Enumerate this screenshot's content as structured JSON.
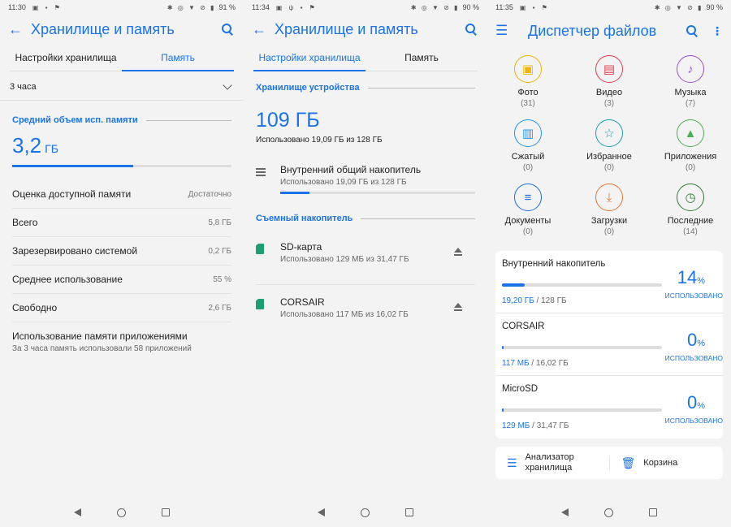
{
  "panels": [
    {
      "status": {
        "time": "11:30",
        "battery": "91 %"
      },
      "title": "Хранилище и память",
      "tabs": [
        "Настройки хранилища",
        "Память"
      ],
      "period": "3 часа",
      "section": "Средний объем исп. памяти",
      "big_value": "3,2",
      "big_unit": "ГБ",
      "bar_fraction": 0.55,
      "rows": [
        {
          "k": "Оценка доступной памяти",
          "v": "Достаточно"
        },
        {
          "k": "Всего",
          "v": "5,8 ГБ"
        },
        {
          "k": "Зарезервировано системой",
          "v": "0,2 ГБ"
        },
        {
          "k": "Среднее использование",
          "v": "55 %"
        },
        {
          "k": "Свободно",
          "v": "2,6 ГБ"
        }
      ],
      "apps_title": "Использование памяти приложениями",
      "apps_sub": "За 3 часа память использовали 58 приложений"
    },
    {
      "status": {
        "time": "11:34",
        "battery": "90 %"
      },
      "title": "Хранилище и память",
      "tabs": [
        "Настройки хранилища",
        "Память"
      ],
      "device_section": "Хранилище устройства",
      "device_total": "109 ГБ",
      "device_used": "Использовано 19,09 ГБ из 128 ГБ",
      "internal": {
        "title": "Внутренний общий накопитель",
        "sub": "Использовано 19,09 ГБ из 128 ГБ",
        "fraction": 0.15
      },
      "removable_section": "Съемный накопитель",
      "removable": [
        {
          "title": "SD-карта",
          "sub": "Использовано 129 МБ из 31,47 ГБ"
        },
        {
          "title": "CORSAIR",
          "sub": "Использовано 117 МБ из 16,02 ГБ"
        }
      ]
    },
    {
      "status": {
        "time": "11:35",
        "battery": "90 %"
      },
      "title": "Диспетчер файлов",
      "categories": [
        {
          "label": "Фото",
          "count": "(31)",
          "icon": "photo-icon",
          "glyph": "▣",
          "color": "#f0b400"
        },
        {
          "label": "Видео",
          "count": "(3)",
          "icon": "video-icon",
          "glyph": "▤",
          "color": "#e53950"
        },
        {
          "label": "Музыка",
          "count": "(7)",
          "icon": "music-icon",
          "glyph": "♪",
          "color": "#9a4fd1"
        },
        {
          "label": "Сжатый",
          "count": "(0)",
          "icon": "archive-icon",
          "glyph": "▥",
          "color": "#2196f3"
        },
        {
          "label": "Избранное",
          "count": "(0)",
          "icon": "star-icon",
          "glyph": "☆",
          "color": "#15a1a8"
        },
        {
          "label": "Приложения",
          "count": "(0)",
          "icon": "android-icon",
          "glyph": "▲",
          "color": "#4caf50"
        },
        {
          "label": "Документы",
          "count": "(0)",
          "icon": "document-icon",
          "glyph": "≡",
          "color": "#1e6ed8"
        },
        {
          "label": "Загрузки",
          "count": "(0)",
          "icon": "download-icon",
          "glyph": "⤓",
          "color": "#e8772e"
        },
        {
          "label": "Последние",
          "count": "(14)",
          "icon": "history-icon",
          "glyph": "◷",
          "color": "#2e7d32"
        }
      ],
      "storages": [
        {
          "name": "Внутренний накопитель",
          "pct": "14",
          "used_label": "ИСПОЛЬЗОВАНО",
          "used": "19,20 ГБ",
          "total": " / 128 ГБ",
          "fraction": 0.14
        },
        {
          "name": "CORSAIR",
          "pct": "0",
          "used_label": "ИСПОЛЬЗОВАНО",
          "used": "117 МБ",
          "total": " / 16,02 ГБ",
          "fraction": 0.007
        },
        {
          "name": "MicroSD",
          "pct": "0",
          "used_label": "ИСПОЛЬЗОВАНО",
          "used": "129 МБ",
          "total": " / 31,47 ГБ",
          "fraction": 0.004
        }
      ],
      "pct_sign": "%",
      "tools": [
        {
          "label": "Анализатор хранилища"
        },
        {
          "label": "Корзина"
        }
      ]
    }
  ]
}
